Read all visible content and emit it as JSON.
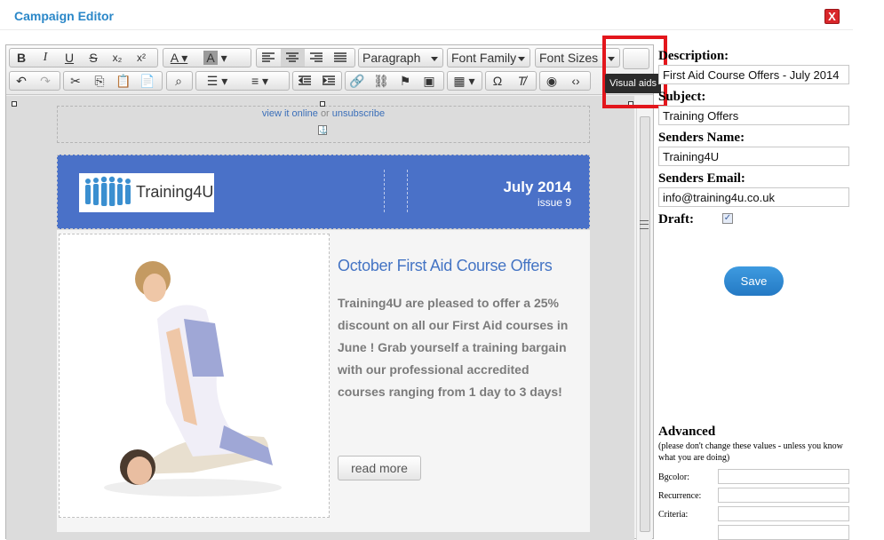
{
  "window": {
    "title": "Campaign Editor",
    "close_label": "X"
  },
  "toolbar": {
    "row1": [
      {
        "name": "bold-button",
        "label": "B"
      },
      {
        "name": "italic-button",
        "label": "I"
      },
      {
        "name": "underline-button",
        "label": "U"
      },
      {
        "name": "strikethrough-button",
        "label": "S"
      },
      {
        "name": "subscript-button",
        "label": "x₂"
      },
      {
        "name": "superscript-button",
        "label": "x²"
      }
    ],
    "format_select": "Paragraph",
    "font_family_select": "Font Family",
    "font_size_select": "Font Sizes",
    "visual_aids_tooltip": "Visual aids"
  },
  "email": {
    "preheader_link1": "view it online",
    "preheader_or": "or",
    "preheader_link2": "unsubscribe",
    "logo_text": "Training4U",
    "date": "July 2014",
    "issue": "issue 9",
    "headline": "October First Aid Course Offers",
    "body_text": "Training4U are pleased to offer a 25% discount on all our First Aid courses in June ! Grab yourself a training bargain with our professional accredited courses ranging from 1 day to 3 days!",
    "read_more": "read more"
  },
  "form": {
    "description_label": "Description:",
    "description_value": "First Aid Course Offers - July 2014",
    "subject_label": "Subject:",
    "subject_value": "Training Offers",
    "senders_name_label": "Senders Name:",
    "senders_name_value": "Training4U",
    "senders_email_label": "Senders Email:",
    "senders_email_value": "info@training4u.co.uk",
    "draft_label": "Draft:",
    "draft_checked": true,
    "save_label": "Save",
    "advanced_label": "Advanced",
    "advanced_note": "(please don't change these values - unless you know what you are doing)",
    "bgcolor_label": "Bgcolor:",
    "recurrence_label": "Recurrence:",
    "criteria_label": "Criteria:"
  },
  "colors": {
    "accent": "#2a87c8",
    "banner": "#4a71c8",
    "highlight": "#e3161c"
  }
}
